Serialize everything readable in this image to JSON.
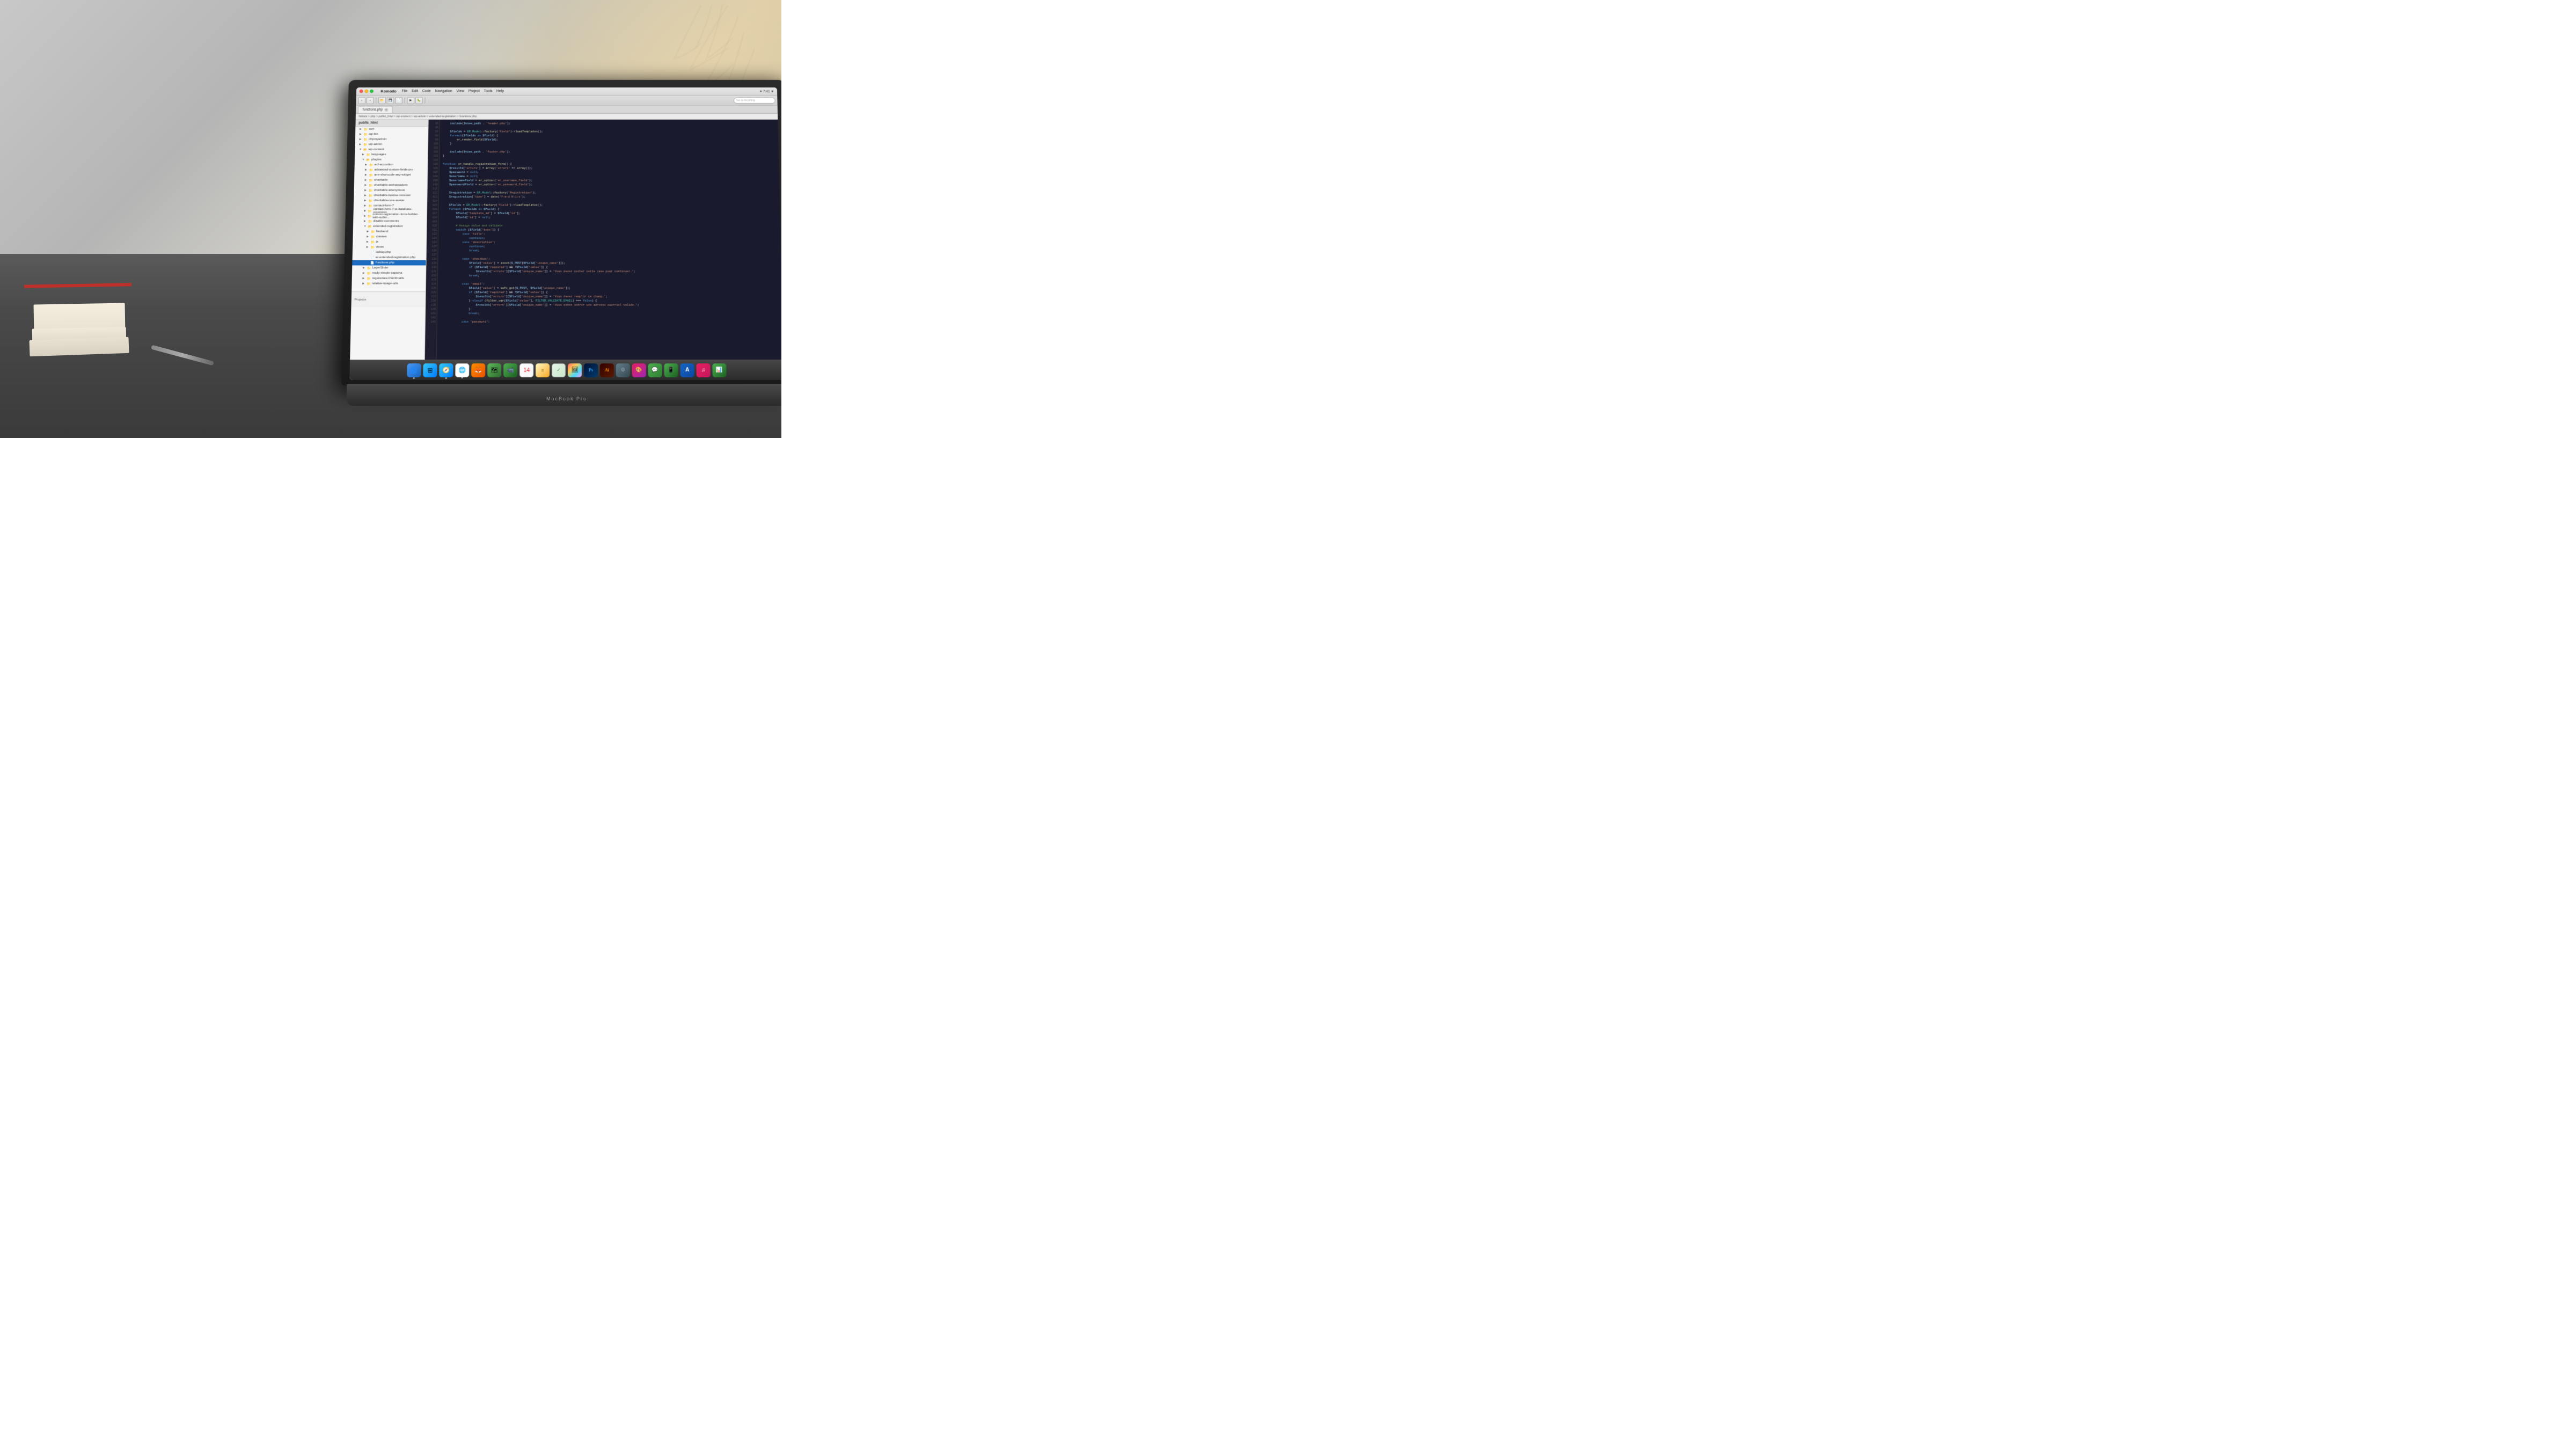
{
  "scene": {
    "laptop_label": "MacBook Pro",
    "wall_bg": "#c0bdb6",
    "desk_bg": "#4a4a4a"
  },
  "ide": {
    "app_name": "Komodo",
    "menu_items": [
      "File",
      "Edit",
      "Code",
      "Navigation",
      "View",
      "Project",
      "Tools",
      "Help"
    ],
    "menu_right": "✦ 7:41  ▼",
    "toolbar_search_placeholder": "Go to Anything",
    "tab_name": "functions.php",
    "breadcrumb": "htdocs > php > public_html > wp-content > wp-admin > extended-registration > functions.php",
    "file_tree_header": "public_html",
    "file_tree_items": [
      {
        "label": "cert",
        "indent": 1,
        "type": "folder"
      },
      {
        "label": "cgi-bin",
        "indent": 1,
        "type": "folder"
      },
      {
        "label": "phpmyadmin",
        "indent": 1,
        "type": "folder"
      },
      {
        "label": "wp-admin",
        "indent": 1,
        "type": "folder"
      },
      {
        "label": "wp-content",
        "indent": 1,
        "type": "folder",
        "open": true
      },
      {
        "label": "languages",
        "indent": 2,
        "type": "folder"
      },
      {
        "label": "plugins",
        "indent": 2,
        "type": "folder",
        "open": true
      },
      {
        "label": "acf-accordion",
        "indent": 3,
        "type": "folder"
      },
      {
        "label": "advanced-custom-fields-pro",
        "indent": 3,
        "type": "folder"
      },
      {
        "label": "amr-shortcode-any-widget",
        "indent": 3,
        "type": "folder"
      },
      {
        "label": "charitable",
        "indent": 3,
        "type": "folder"
      },
      {
        "label": "charitable-ambassadors",
        "indent": 3,
        "type": "folder"
      },
      {
        "label": "charitable-anonymous",
        "indent": 3,
        "type": "folder"
      },
      {
        "label": "charitable-license-renewer",
        "indent": 3,
        "type": "folder"
      },
      {
        "label": "charitable-core-avatar",
        "indent": 3,
        "type": "folder"
      },
      {
        "label": "contact-form-7",
        "indent": 3,
        "type": "folder"
      },
      {
        "label": "contact-form-7-to-database-extension",
        "indent": 3,
        "type": "folder"
      },
      {
        "label": "custom-registration-form-builder-with-submissio...",
        "indent": 3,
        "type": "folder"
      },
      {
        "label": "disable-comments",
        "indent": 3,
        "type": "folder"
      },
      {
        "label": "extended-registration",
        "indent": 3,
        "type": "folder",
        "open": true
      },
      {
        "label": "backend",
        "indent": 4,
        "type": "folder"
      },
      {
        "label": "classes",
        "indent": 4,
        "type": "folder"
      },
      {
        "label": "js",
        "indent": 4,
        "type": "folder"
      },
      {
        "label": "views",
        "indent": 4,
        "type": "folder"
      },
      {
        "label": "debug.php",
        "indent": 4,
        "type": "file"
      },
      {
        "label": "er-extended-registration.php",
        "indent": 4,
        "type": "file"
      },
      {
        "label": "functions.php",
        "indent": 4,
        "type": "file",
        "selected": true
      },
      {
        "label": "LayerSlider",
        "indent": 3,
        "type": "folder"
      },
      {
        "label": "really-simple-captcha",
        "indent": 3,
        "type": "folder"
      },
      {
        "label": "regenerate-thumbnails",
        "indent": 3,
        "type": "folder"
      },
      {
        "label": "relative-image-urls",
        "indent": 3,
        "type": "folder"
      }
    ],
    "projects_label": "Projects",
    "code_lines": [
      {
        "num": "95",
        "code": "    include($view_path . 'header.php');"
      },
      {
        "num": "96",
        "code": ""
      },
      {
        "num": "97",
        "code": "    $fields = ER_Model::factory('Field')->loadTemplates();"
      },
      {
        "num": "98",
        "code": "    foreach($fields as $field) {"
      },
      {
        "num": "99",
        "code": "        er_render_field($field);"
      },
      {
        "num": "100",
        "code": "    }"
      },
      {
        "num": "101",
        "code": ""
      },
      {
        "num": "102",
        "code": "    include($view_path . 'footer.php');"
      },
      {
        "num": "103",
        "code": "}"
      },
      {
        "num": "104",
        "code": ""
      },
      {
        "num": "105",
        "code": "function er_handle_registration_form() {"
      },
      {
        "num": "106",
        "code": "    $results['errors'] = array('errors' => array());"
      },
      {
        "num": "107",
        "code": "    $password = null;"
      },
      {
        "num": "108",
        "code": "    $username = null;"
      },
      {
        "num": "109",
        "code": "    $usernameField = er_option('er_username_field');"
      },
      {
        "num": "110",
        "code": "    $passwordField = er_option('er_password_field');"
      },
      {
        "num": "111",
        "code": ""
      },
      {
        "num": "112",
        "code": "    $registration = ER_Model::factory('Registration');"
      },
      {
        "num": "113",
        "code": "    $registration['time'] = date('Y-m-d H:i:s');"
      },
      {
        "num": "114",
        "code": ""
      },
      {
        "num": "115",
        "code": "    $fields = ER_Model::factory('Field')->loadTemplates();"
      },
      {
        "num": "116",
        "code": "    foreach ($fields as $field) {"
      },
      {
        "num": "117",
        "code": "        $field['template_id'] = $field['id'];"
      },
      {
        "num": "118",
        "code": "        $field['id'] = null;"
      },
      {
        "num": "119",
        "code": ""
      },
      {
        "num": "120",
        "code": "        # Assign value and validate"
      },
      {
        "num": "121",
        "code": "        switch ($field['type']) {"
      },
      {
        "num": "122",
        "code": "            case 'title':"
      },
      {
        "num": "123",
        "code": "                continue;"
      },
      {
        "num": "124",
        "code": "            case 'description':"
      },
      {
        "num": "125",
        "code": "                continue;"
      },
      {
        "num": "126",
        "code": "                break;"
      },
      {
        "num": "127",
        "code": ""
      },
      {
        "num": "128",
        "code": "            case 'checkbox':"
      },
      {
        "num": "129",
        "code": "                $field['value'] = isset($_POST[$field['unique_name']]);"
      },
      {
        "num": "130",
        "code": "                if ($field['required'] && !$field['value']) {"
      },
      {
        "num": "131",
        "code": "                    $results['errors'][$field['unique_name']] = 'Vous devez cocher cette case pour continuer.';"
      },
      {
        "num": "132",
        "code": "                break;"
      },
      {
        "num": "133",
        "code": ""
      },
      {
        "num": "134",
        "code": "            case 'email':"
      },
      {
        "num": "135",
        "code": "                $field['value'] = safe_get($_POST, $field['unique_name']);"
      },
      {
        "num": "136",
        "code": "                if ($field['required'] && !$field['value']) {"
      },
      {
        "num": "137",
        "code": "                    $results['errors'][$field['unique_name']] = 'Vous devez remplir ce champ.';"
      },
      {
        "num": "138",
        "code": "                } elseif (filter_var($field['value'], FILTER_VALIDATE_EMAIL) === false) {"
      },
      {
        "num": "139",
        "code": "                    $results['errors'][$field['unique_name']] = 'Vous devez entrer une adresse courriel valide.';"
      },
      {
        "num": "140",
        "code": "                }"
      },
      {
        "num": "141",
        "code": "                break;"
      },
      {
        "num": "142",
        "code": ""
      },
      {
        "num": "143",
        "code": "            case 'password':"
      }
    ]
  },
  "dock": {
    "icons": [
      {
        "name": "Finder",
        "class": "dock-icon-finder",
        "symbol": "🔵",
        "active": true
      },
      {
        "name": "Launchpad",
        "class": "dock-icon-safari",
        "symbol": "🚀",
        "active": false
      },
      {
        "name": "Safari",
        "class": "dock-icon-safari",
        "symbol": "🧭",
        "active": true
      },
      {
        "name": "Chrome",
        "class": "dock-icon-chrome",
        "symbol": "🌐",
        "active": true
      },
      {
        "name": "Firefox",
        "class": "dock-icon-firefox",
        "symbol": "🦊",
        "active": false
      },
      {
        "name": "Maps",
        "class": "dock-icon-maps",
        "symbol": "🗺",
        "active": false
      },
      {
        "name": "FaceTime",
        "class": "dock-icon-facetime",
        "symbol": "📹",
        "active": false
      },
      {
        "name": "Calendar",
        "class": "dock-icon-calendar",
        "symbol": "📅",
        "active": false
      },
      {
        "name": "Notes",
        "class": "dock-icon-notes",
        "symbol": "📝",
        "active": false
      },
      {
        "name": "Reminders",
        "class": "dock-icon-reminders",
        "symbol": "✅",
        "active": false
      },
      {
        "name": "Photos",
        "class": "dock-icon-photos",
        "symbol": "🖼",
        "active": false
      },
      {
        "name": "Photoshop",
        "class": "dock-icon-photoshop",
        "symbol": "Ps",
        "active": false
      },
      {
        "name": "Illustrator",
        "class": "dock-icon-illustrator",
        "symbol": "Ai",
        "active": false
      },
      {
        "name": "Unknown",
        "class": "dock-icon-unknown1",
        "symbol": "⚙",
        "active": false
      },
      {
        "name": "ColorPicker",
        "class": "dock-icon-colorpicker",
        "symbol": "🎨",
        "active": false
      },
      {
        "name": "Messages",
        "class": "dock-icon-messages",
        "symbol": "💬",
        "active": false
      },
      {
        "name": "FaceTime2",
        "class": "dock-icon-facetime2",
        "symbol": "📱",
        "active": false
      },
      {
        "name": "AppStore",
        "class": "dock-icon-appstore",
        "symbol": "A",
        "active": false
      },
      {
        "name": "iTunes",
        "class": "dock-icon-itunes",
        "symbol": "♫",
        "active": false
      },
      {
        "name": "Numbers",
        "class": "dock-icon-numbers",
        "symbol": "📊",
        "active": false
      }
    ]
  }
}
